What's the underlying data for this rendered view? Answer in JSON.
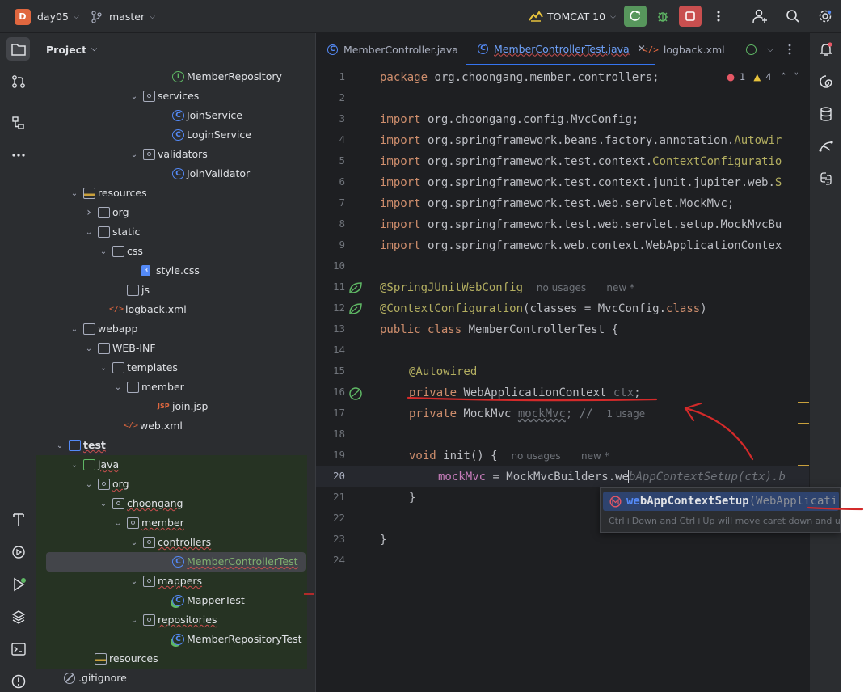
{
  "titlebar": {
    "project_badge": "D",
    "project_name": "day05",
    "branch_name": "master",
    "run_config": "TOMCAT 10",
    "icons": [
      "vcs-branch-icon",
      "tomcat-icon",
      "rerun-icon",
      "debug-icon",
      "stop-icon",
      "more-icon",
      "add-user-icon",
      "search-icon",
      "settings-icon"
    ]
  },
  "project_panel": {
    "title": "Project",
    "tree": [
      {
        "label": "MemberRepository",
        "kind": "interface"
      },
      {
        "label": "services",
        "kind": "package",
        "expanded": true
      },
      {
        "label": "JoinService",
        "kind": "class"
      },
      {
        "label": "LoginService",
        "kind": "class"
      },
      {
        "label": "validators",
        "kind": "package",
        "expanded": true
      },
      {
        "label": "JoinValidator",
        "kind": "class"
      },
      {
        "label": "resources",
        "kind": "resources",
        "expanded": true
      },
      {
        "label": "org",
        "kind": "folder",
        "expanded": false
      },
      {
        "label": "static",
        "kind": "folder",
        "expanded": true
      },
      {
        "label": "css",
        "kind": "folder",
        "expanded": true
      },
      {
        "label": "style.css",
        "kind": "css"
      },
      {
        "label": "js",
        "kind": "folder"
      },
      {
        "label": "logback.xml",
        "kind": "xml"
      },
      {
        "label": "webapp",
        "kind": "folder",
        "expanded": true
      },
      {
        "label": "WEB-INF",
        "kind": "folder",
        "expanded": true
      },
      {
        "label": "templates",
        "kind": "folder",
        "expanded": true
      },
      {
        "label": "member",
        "kind": "folder",
        "expanded": true
      },
      {
        "label": "join.jsp",
        "kind": "jsp"
      },
      {
        "label": "web.xml",
        "kind": "webxml"
      },
      {
        "label": "test",
        "kind": "module",
        "expanded": true
      },
      {
        "label": "java",
        "kind": "testroot",
        "expanded": true
      },
      {
        "label": "org",
        "kind": "package",
        "expanded": true
      },
      {
        "label": "choongang",
        "kind": "package",
        "expanded": true
      },
      {
        "label": "member",
        "kind": "package",
        "expanded": true
      },
      {
        "label": "controllers",
        "kind": "package",
        "expanded": true
      },
      {
        "label": "MemberControllerTest",
        "kind": "class",
        "selected": true
      },
      {
        "label": "mappers",
        "kind": "package",
        "expanded": true
      },
      {
        "label": "MapperTest",
        "kind": "testclass"
      },
      {
        "label": "repositories",
        "kind": "package",
        "expanded": true
      },
      {
        "label": "MemberRepositoryTest",
        "kind": "testclass"
      },
      {
        "label": "resources",
        "kind": "resources"
      },
      {
        "label": ".gitignore",
        "kind": "ignore"
      }
    ]
  },
  "editor": {
    "tabs": [
      {
        "label": "MemberController.java",
        "active": false
      },
      {
        "label": "MemberControllerTest.java",
        "active": true
      },
      {
        "label": "logback.xml",
        "active": false
      }
    ],
    "inspections": {
      "errors": "1",
      "warnings": "4"
    },
    "line_numbers": [
      "1",
      "2",
      "3",
      "4",
      "5",
      "6",
      "7",
      "8",
      "9",
      "10",
      "11",
      "12",
      "13",
      "14",
      "15",
      "16",
      "17",
      "18",
      "19",
      "20",
      "21",
      "22",
      "23",
      "24"
    ],
    "current_line": "20",
    "code": {
      "l1_kw": "package",
      "l1_rest": " org.choongang.member.controllers;",
      "imp": "import",
      "l3": " org.choongang.config.MvcConfig;",
      "l4a": " org.springframework.beans.factory.annotation.",
      "l4b": "Autowir",
      "l5a": " org.springframework.test.context.",
      "l5b": "ContextConfiguratio",
      "l6a": " org.springframework.test.context.junit.jupiter.web.",
      "l6b": "S",
      "l7": " org.springframework.test.web.servlet.MockMvc;",
      "l8": " org.springframework.test.web.servlet.setup.MockMvcBu",
      "l9": " org.springframework.web.context.WebApplicationContex",
      "l11_ann": "@SpringJUnitWebConfig",
      "l11_hint1": "no usages",
      "l11_hint2": "new *",
      "l12_ann": "@ContextConfiguration",
      "l12_rest": "(classes = MvcConfig.",
      "l12_kw": "class",
      "l12_end": ")",
      "l13_kw": "public class",
      "l13_rest": " MemberControllerTest {",
      "l15_ann": "@Autowired",
      "l16_kw": "private",
      "l16_ty": " WebApplicationContext ",
      "l16_fld": "ctx",
      "l16_end": ";",
      "l17_kw": "private",
      "l17_ty": " MockMvc ",
      "l17_fld": "mockMvc",
      "l17_end": "; //",
      "l17_hint": "1 usage",
      "l19_kw": "void",
      "l19_rest": " init() {",
      "l19_hint1": "no usages",
      "l19_hint2": "new *",
      "l20_fld": "mockMvc",
      "l20_rest": " = MockMvcBuilders.we",
      "l20_ghost": "bAppContextSetup(ctx).b",
      "l21": "}",
      "l23": "}"
    },
    "completion": {
      "match": "we",
      "rest": "bAppContextSetup",
      "params": "(WebApplicati",
      "hint": "Ctrl+Down and Ctrl+Up will move caret down and up in t"
    }
  },
  "left_strip_icons": [
    "project-icon",
    "commit-icon",
    "structure-icon",
    "more-tools-icon",
    "build-icon",
    "services-icon",
    "run-icon",
    "layers-icon",
    "terminal-icon",
    "problems-icon"
  ],
  "right_strip_icons": [
    "notifications-icon",
    "ai-assistant-icon",
    "database-icon",
    "endpoints-icon",
    "python-icon"
  ],
  "colors": {
    "annotation_red": "#d42a2a",
    "accent": "#3574f0"
  }
}
